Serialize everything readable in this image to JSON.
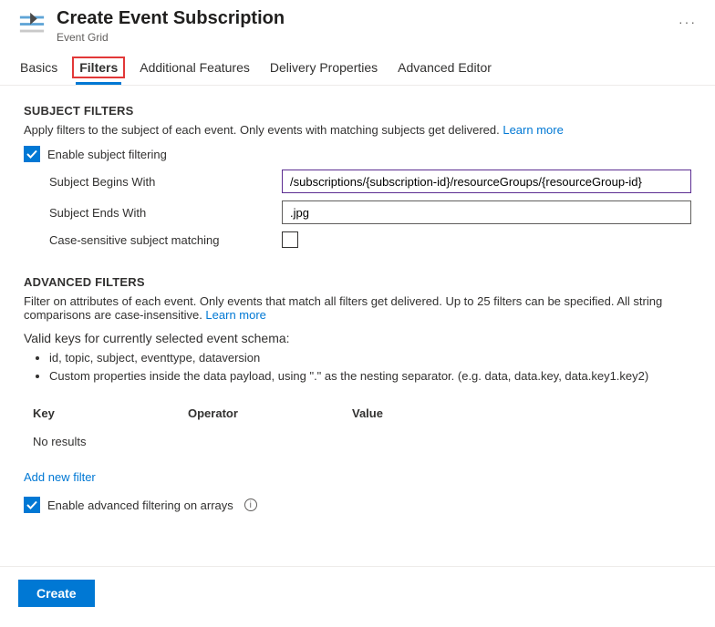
{
  "header": {
    "title": "Create Event Subscription",
    "subtitle": "Event Grid",
    "more_label": "···"
  },
  "tabs": [
    {
      "id": "basics",
      "label": "Basics",
      "active": false
    },
    {
      "id": "filters",
      "label": "Filters",
      "active": true
    },
    {
      "id": "additional",
      "label": "Additional Features",
      "active": false
    },
    {
      "id": "delivery",
      "label": "Delivery Properties",
      "active": false
    },
    {
      "id": "advanced-editor",
      "label": "Advanced Editor",
      "active": false
    }
  ],
  "subject_filters": {
    "heading": "SUBJECT FILTERS",
    "description": "Apply filters to the subject of each event. Only events with matching subjects get delivered. ",
    "learn_more": "Learn more",
    "enable_label": "Enable subject filtering",
    "enable_checked": true,
    "begins_label": "Subject Begins With",
    "begins_value": "/subscriptions/{subscription-id}/resourceGroups/{resourceGroup-id}",
    "ends_label": "Subject Ends With",
    "ends_value": ".jpg",
    "case_label": "Case-sensitive subject matching",
    "case_checked": false
  },
  "advanced_filters": {
    "heading": "ADVANCED FILTERS",
    "description": "Filter on attributes of each event. Only events that match all filters get delivered. Up to 25 filters can be specified. All string comparisons are case-insensitive. ",
    "learn_more": "Learn more",
    "valid_keys_title": "Valid keys for currently selected event schema:",
    "valid_keys": [
      "id, topic, subject, eventtype, dataversion",
      "Custom properties inside the data payload, using \".\" as the nesting separator. (e.g. data, data.key, data.key1.key2)"
    ],
    "columns": {
      "key": "Key",
      "operator": "Operator",
      "value": "Value"
    },
    "no_results": "No results",
    "add_new": "Add new filter",
    "enable_arrays_label": "Enable advanced filtering on arrays",
    "enable_arrays_checked": true
  },
  "footer": {
    "create_label": "Create"
  }
}
